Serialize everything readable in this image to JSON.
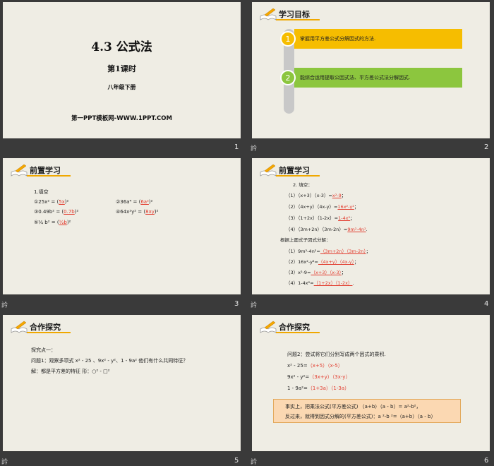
{
  "slides": [
    {
      "number": "1",
      "title_main": "4.3 公式法",
      "subtitle": "第1课时",
      "grade": "八年级下册",
      "site": "第一PPT模板网-WWW.1PPT.COM"
    },
    {
      "number": "2",
      "mark": "訡",
      "header": "学习目标",
      "goals": [
        {
          "index": "1",
          "text": "掌握用平方差公式分解因式的方法."
        },
        {
          "index": "2",
          "text": "能综合运用提取公因式法、平方差公式法分解因式."
        }
      ]
    },
    {
      "number": "3",
      "mark": "訡",
      "header": "前置学习",
      "intro": "1.填空",
      "items": [
        {
          "left": "①25x² = (",
          "ans": "5x",
          "right": ")²"
        },
        {
          "left": "②36a⁴ = (",
          "ans": "6a²",
          "right": ")²"
        },
        {
          "left": "③0.49b² = (",
          "ans": "0.7b",
          "right": ")²"
        },
        {
          "left": "④64x²y² = (",
          "ans": "8xy",
          "right": ")²"
        },
        {
          "left": "⑤¼ b² = (",
          "ans": "½b",
          "right": ")²"
        }
      ]
    },
    {
      "number": "4",
      "mark": "訡",
      "header": "前置学习",
      "intro": "2. 填空：",
      "fill": [
        {
          "left": "（1）（x+3）（x-3）=",
          "ans": "x²-9",
          "right": "；"
        },
        {
          "left": "（2）（4x+y）（4x-y）=",
          "ans": "16x²-y²",
          "right": "；"
        },
        {
          "left": "（3）（1+2x）（1-2x）=",
          "ans": "1-4x²",
          "right": "；"
        },
        {
          "left": "（4）（3m+2n）（3m-2n）=",
          "ans": "9m²-4n²",
          "right": "."
        }
      ],
      "intro2": "根据上面式子因式分解：",
      "factor": [
        {
          "left": "（1）9m²-4n²=",
          "ans": "（3m+2n）（3m-2n）",
          "right": "；"
        },
        {
          "left": "（2）16x²-y²=",
          "ans": "（4x+y）（4x-y）",
          "right": "；"
        },
        {
          "left": "（3）x²-9=",
          "ans": "（x+3）（x-3）",
          "right": "；"
        },
        {
          "left": "（4）1-4x²=",
          "ans": "（1+2x）（1-2x）",
          "right": "."
        }
      ]
    },
    {
      "number": "5",
      "mark": "訡",
      "header": "合作探究",
      "point": "探究点一：",
      "question": "问题1：观察多项式 x² - 25 、9x² - y²、1 - 9a² 他们有什么共同特征？",
      "answer": "解：都是平方差的特征 形：○² - □²"
    },
    {
      "number": "6",
      "mark": "訡",
      "header": "合作探究",
      "question": "问题2：尝试将它们分别写成两个因式的乘积.",
      "rows": [
        {
          "left": "x² - 25=",
          "ans": "（x+5）（x-5）"
        },
        {
          "left": "9x² - y²=",
          "ans": "（3x+y）（3x-y）"
        },
        {
          "left": "1 - 9a²=",
          "ans": "（1+3a）（1-3a）"
        }
      ],
      "box_line1": "事实上，把乘法公式(平方差公式)  （a+b）（a - b）= a²-b²，",
      "box_line2": "反过来，就得到因式分解的(平方差公式)：a ²-b ²=（a+b）（a - b）"
    }
  ],
  "colors": {
    "gold": "#f6bd00",
    "green": "#8cc63e",
    "answer_red": "#e23a2c"
  }
}
